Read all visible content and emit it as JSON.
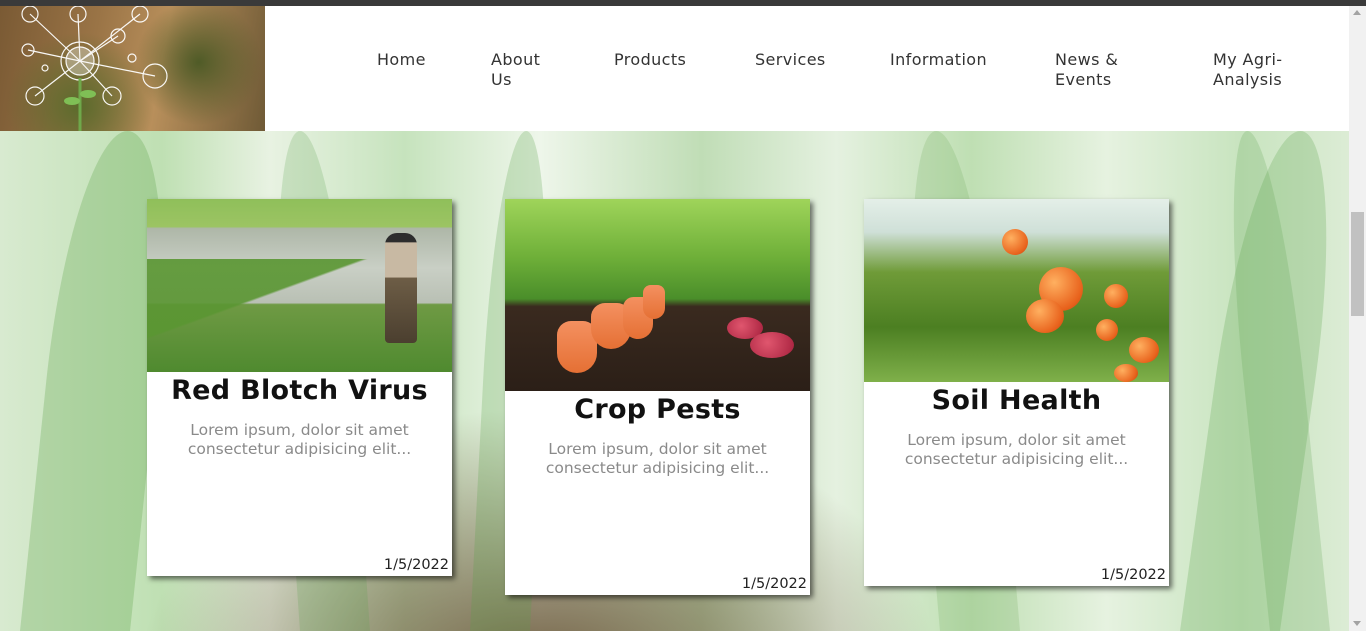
{
  "nav": {
    "items": [
      {
        "label_line1": "Home",
        "label_line2": ""
      },
      {
        "label_line1": "About",
        "label_line2": "Us"
      },
      {
        "label_line1": "Products",
        "label_line2": ""
      },
      {
        "label_line1": "Services",
        "label_line2": ""
      },
      {
        "label_line1": "Information",
        "label_line2": ""
      },
      {
        "label_line1": "News &",
        "label_line2": "Events"
      },
      {
        "label_line1": "My Agri-",
        "label_line2": "Analysis"
      }
    ]
  },
  "cards": [
    {
      "title": "Red Blotch Virus",
      "text": "Lorem ipsum, dolor sit amet consectetur adipisicing elit...",
      "date": "1/5/2022",
      "image": "rice-paddy-farmer"
    },
    {
      "title": "Crop Pests",
      "text": "Lorem ipsum, dolor sit amet consectetur adipisicing elit...",
      "date": "1/5/2022",
      "image": "carrots-radishes-soil"
    },
    {
      "title": "Soil Health",
      "text": "Lorem ipsum, dolor sit amet consectetur adipisicing elit...",
      "date": "1/5/2022",
      "image": "orange-tree-orchard"
    }
  ],
  "colors": {
    "nav_text": "#333333",
    "card_title": "#111111",
    "card_text": "#8a8a8a",
    "top_strip": "#3a3a3a"
  }
}
